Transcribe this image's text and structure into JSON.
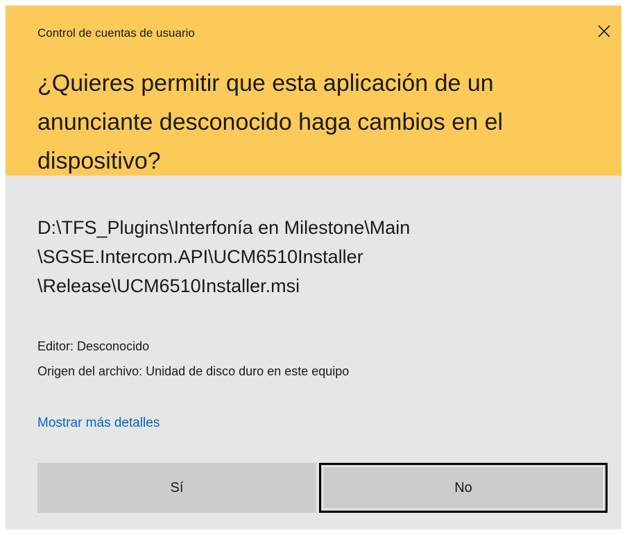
{
  "dialog": {
    "title": "Control de cuentas de usuario",
    "close_icon": "close-icon",
    "question": "¿Quieres permitir que esta aplicación de un anunciante desconocido haga cambios en el dispositivo?",
    "path_lines": [
      "D:\\TFS_Plugins\\Interfonía en Milestone\\Main",
      "\\SGSE.Intercom.API\\UCM6510Installer",
      "\\Release\\UCM6510Installer.msi"
    ],
    "publisher": "Editor: Desconocido",
    "origin": "Origen del archivo: Unidad de disco duro en este equipo",
    "details_link": "Mostrar más detalles",
    "yes_label": "Sí",
    "no_label": "No"
  },
  "colors": {
    "header_bg": "#fcca59",
    "body_bg": "#e6e6e6",
    "link": "#0067c0",
    "button_bg": "#cccccc"
  }
}
